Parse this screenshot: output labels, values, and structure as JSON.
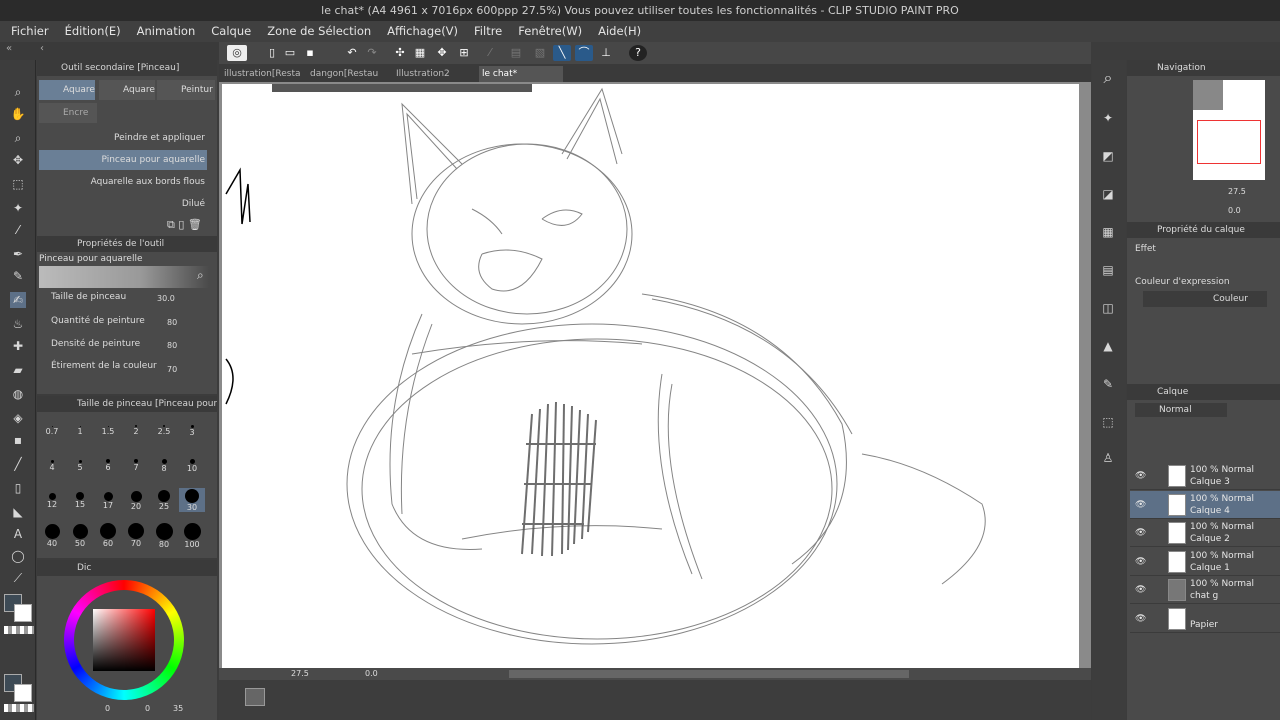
{
  "window": {
    "title": "le chat* (A4 4961 x 7016px 600ppp 27.5%)  Vous pouvez utiliser toutes les fonctionnalités - CLIP STUDIO PAINT PRO"
  },
  "menu": [
    "Fichier",
    "Édition(E)",
    "Animation",
    "Calque",
    "Zone de Sélection",
    "Affichage(V)",
    "Filtre",
    "Fenêtre(W)",
    "Aide(H)"
  ],
  "subtool": {
    "header": "Outil secondaire [Pinceau]",
    "tabs": [
      "Aquare",
      "Aquare",
      "Peintur",
      "Encre"
    ],
    "brushes": [
      "Peindre et appliquer",
      "Pinceau pour aquarelle",
      "Aquarelle aux bords flous",
      "Dilué"
    ]
  },
  "toolprops": {
    "header": "Propriétés de l'outil",
    "name": "Pinceau pour aquarelle",
    "rows": [
      {
        "label": "Taille de pinceau",
        "value": "30.0"
      },
      {
        "label": "Quantité de peinture",
        "value": "80"
      },
      {
        "label": "Densité de peinture",
        "value": "80"
      },
      {
        "label": "Étirement de la couleur",
        "value": "70"
      }
    ]
  },
  "brushsize": {
    "header": "Taille de pinceau [Pinceau pour aqu",
    "sizes": [
      "0.7",
      "1",
      "1.5",
      "2",
      "2.5",
      "3",
      "4",
      "5",
      "6",
      "7",
      "8",
      "10",
      "12",
      "15",
      "17",
      "20",
      "25",
      "30",
      "40",
      "50",
      "60",
      "70",
      "80",
      "100"
    ]
  },
  "color": {
    "header": "Dic",
    "values": [
      "0",
      "0",
      "35"
    ]
  },
  "doc_tabs": [
    "illustration[Resta",
    "dangon[Restau",
    "Illustration2",
    "le chat*"
  ],
  "status": {
    "zoom": "27.5",
    "angle": "0.0"
  },
  "navigator": {
    "header": "Navigation",
    "zoom": "27.5",
    "angle": "0.0"
  },
  "layer_props": {
    "header": "Propriété du calque",
    "effect": "Effet",
    "expr_label": "Couleur d'expression",
    "expr_value": "Couleur"
  },
  "layers_panel": {
    "header": "Calque",
    "blend": "Normal",
    "layers": [
      {
        "mode": "100 % Normal",
        "name": "Calque 3",
        "selected": false
      },
      {
        "mode": "100 % Normal",
        "name": "Calque 4",
        "selected": true
      },
      {
        "mode": "100 % Normal",
        "name": "Calque 2",
        "selected": false
      },
      {
        "mode": "100 % Normal",
        "name": "Calque 1",
        "selected": false
      },
      {
        "mode": "100 % Normal",
        "name": "chat g",
        "selected": false
      },
      {
        "mode": "",
        "name": "Papier",
        "selected": false
      }
    ]
  }
}
